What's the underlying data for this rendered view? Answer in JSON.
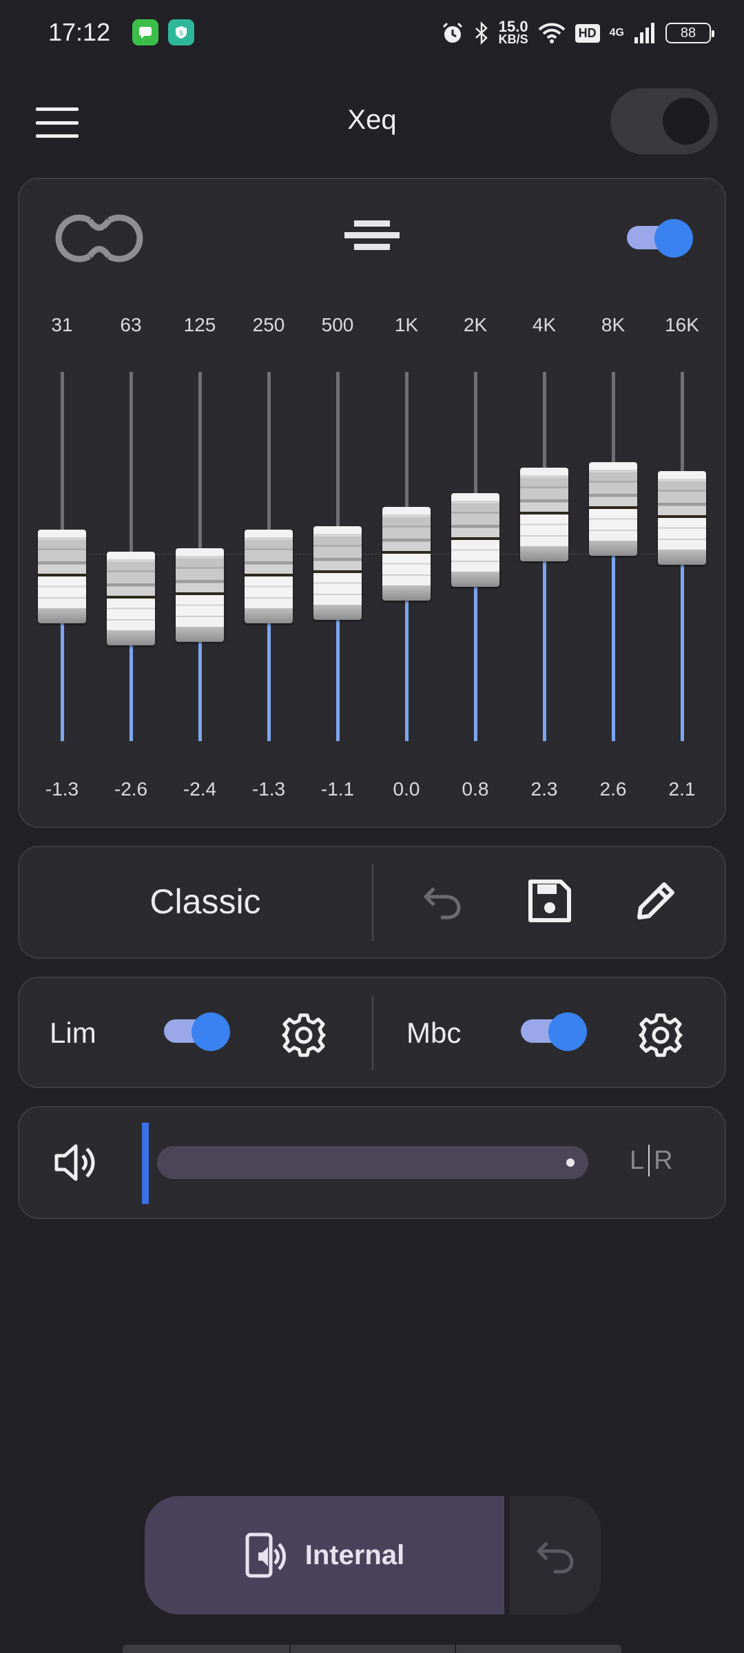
{
  "status_bar": {
    "time": "17:12",
    "net_speed_value": "15.0",
    "net_speed_unit": "KB/S",
    "hd": "HD",
    "network": "4G",
    "battery": "88"
  },
  "app_bar": {
    "title": "Xeq",
    "master_enabled": false
  },
  "equalizer": {
    "enabled": true,
    "bands": [
      {
        "freq": "31",
        "gain": "-1.3"
      },
      {
        "freq": "63",
        "gain": "-2.6"
      },
      {
        "freq": "125",
        "gain": "-2.4"
      },
      {
        "freq": "250",
        "gain": "-1.3"
      },
      {
        "freq": "500",
        "gain": "-1.1"
      },
      {
        "freq": "1K",
        "gain": "0.0"
      },
      {
        "freq": "2K",
        "gain": "0.8"
      },
      {
        "freq": "4K",
        "gain": "2.3"
      },
      {
        "freq": "8K",
        "gain": "2.6"
      },
      {
        "freq": "16K",
        "gain": "2.1"
      }
    ]
  },
  "preset": {
    "name": "Classic"
  },
  "effects": {
    "lim_label": "Lim",
    "lim_enabled": true,
    "mbc_label": "Mbc",
    "mbc_enabled": true
  },
  "volume": {
    "balance_left": "L",
    "balance_right": "R"
  },
  "output": {
    "label": "Internal"
  },
  "colors": {
    "accent": "#3a82f0",
    "slider_fill": "#7ea6ee",
    "background": "#212126",
    "card": "#2b2b2f"
  }
}
